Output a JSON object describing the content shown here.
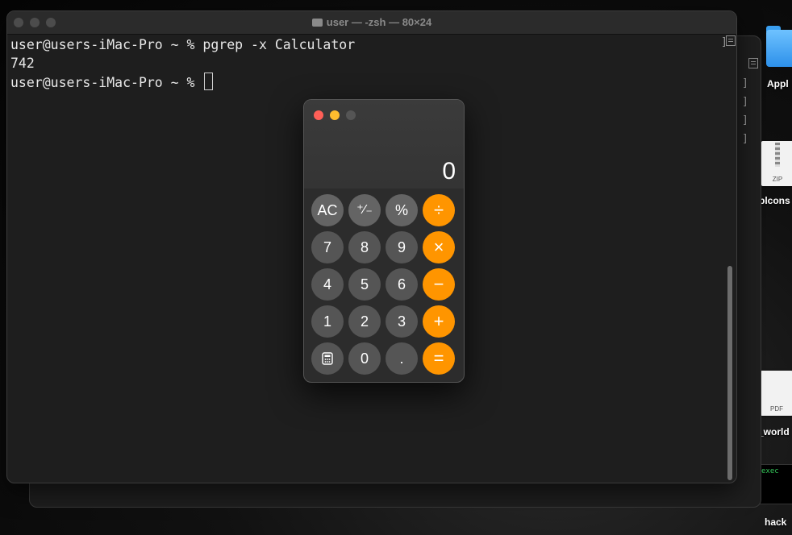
{
  "desktop": {
    "items": [
      {
        "label": "Appl",
        "icon": "folder-icon"
      },
      {
        "label": "plcons",
        "icon": "zip-file-icon",
        "ext": "ZIP"
      },
      {
        "label": "_world",
        "icon": "pdf-file-icon",
        "ext": "PDF"
      },
      {
        "label": "hack",
        "icon": "terminal-window-icon",
        "preview_text": "exec"
      }
    ]
  },
  "terminal": {
    "title": "user — -zsh — 80×24",
    "lines": [
      "user@users-iMac-Pro ~ % pgrep -x Calculator",
      "742",
      "user@users-iMac-Pro ~ % "
    ]
  },
  "calculator": {
    "display": "0",
    "keys": {
      "row1": [
        "AC",
        "⁺∕₋",
        "%",
        "÷"
      ],
      "row2": [
        "7",
        "8",
        "9",
        "×"
      ],
      "row3": [
        "4",
        "5",
        "6",
        "−"
      ],
      "row4": [
        "1",
        "2",
        "3",
        "+"
      ],
      "row5": [
        "",
        "0",
        ".",
        "="
      ]
    },
    "colors": {
      "operator": "#ff9500",
      "function": "#646464",
      "number": "#555555"
    }
  }
}
